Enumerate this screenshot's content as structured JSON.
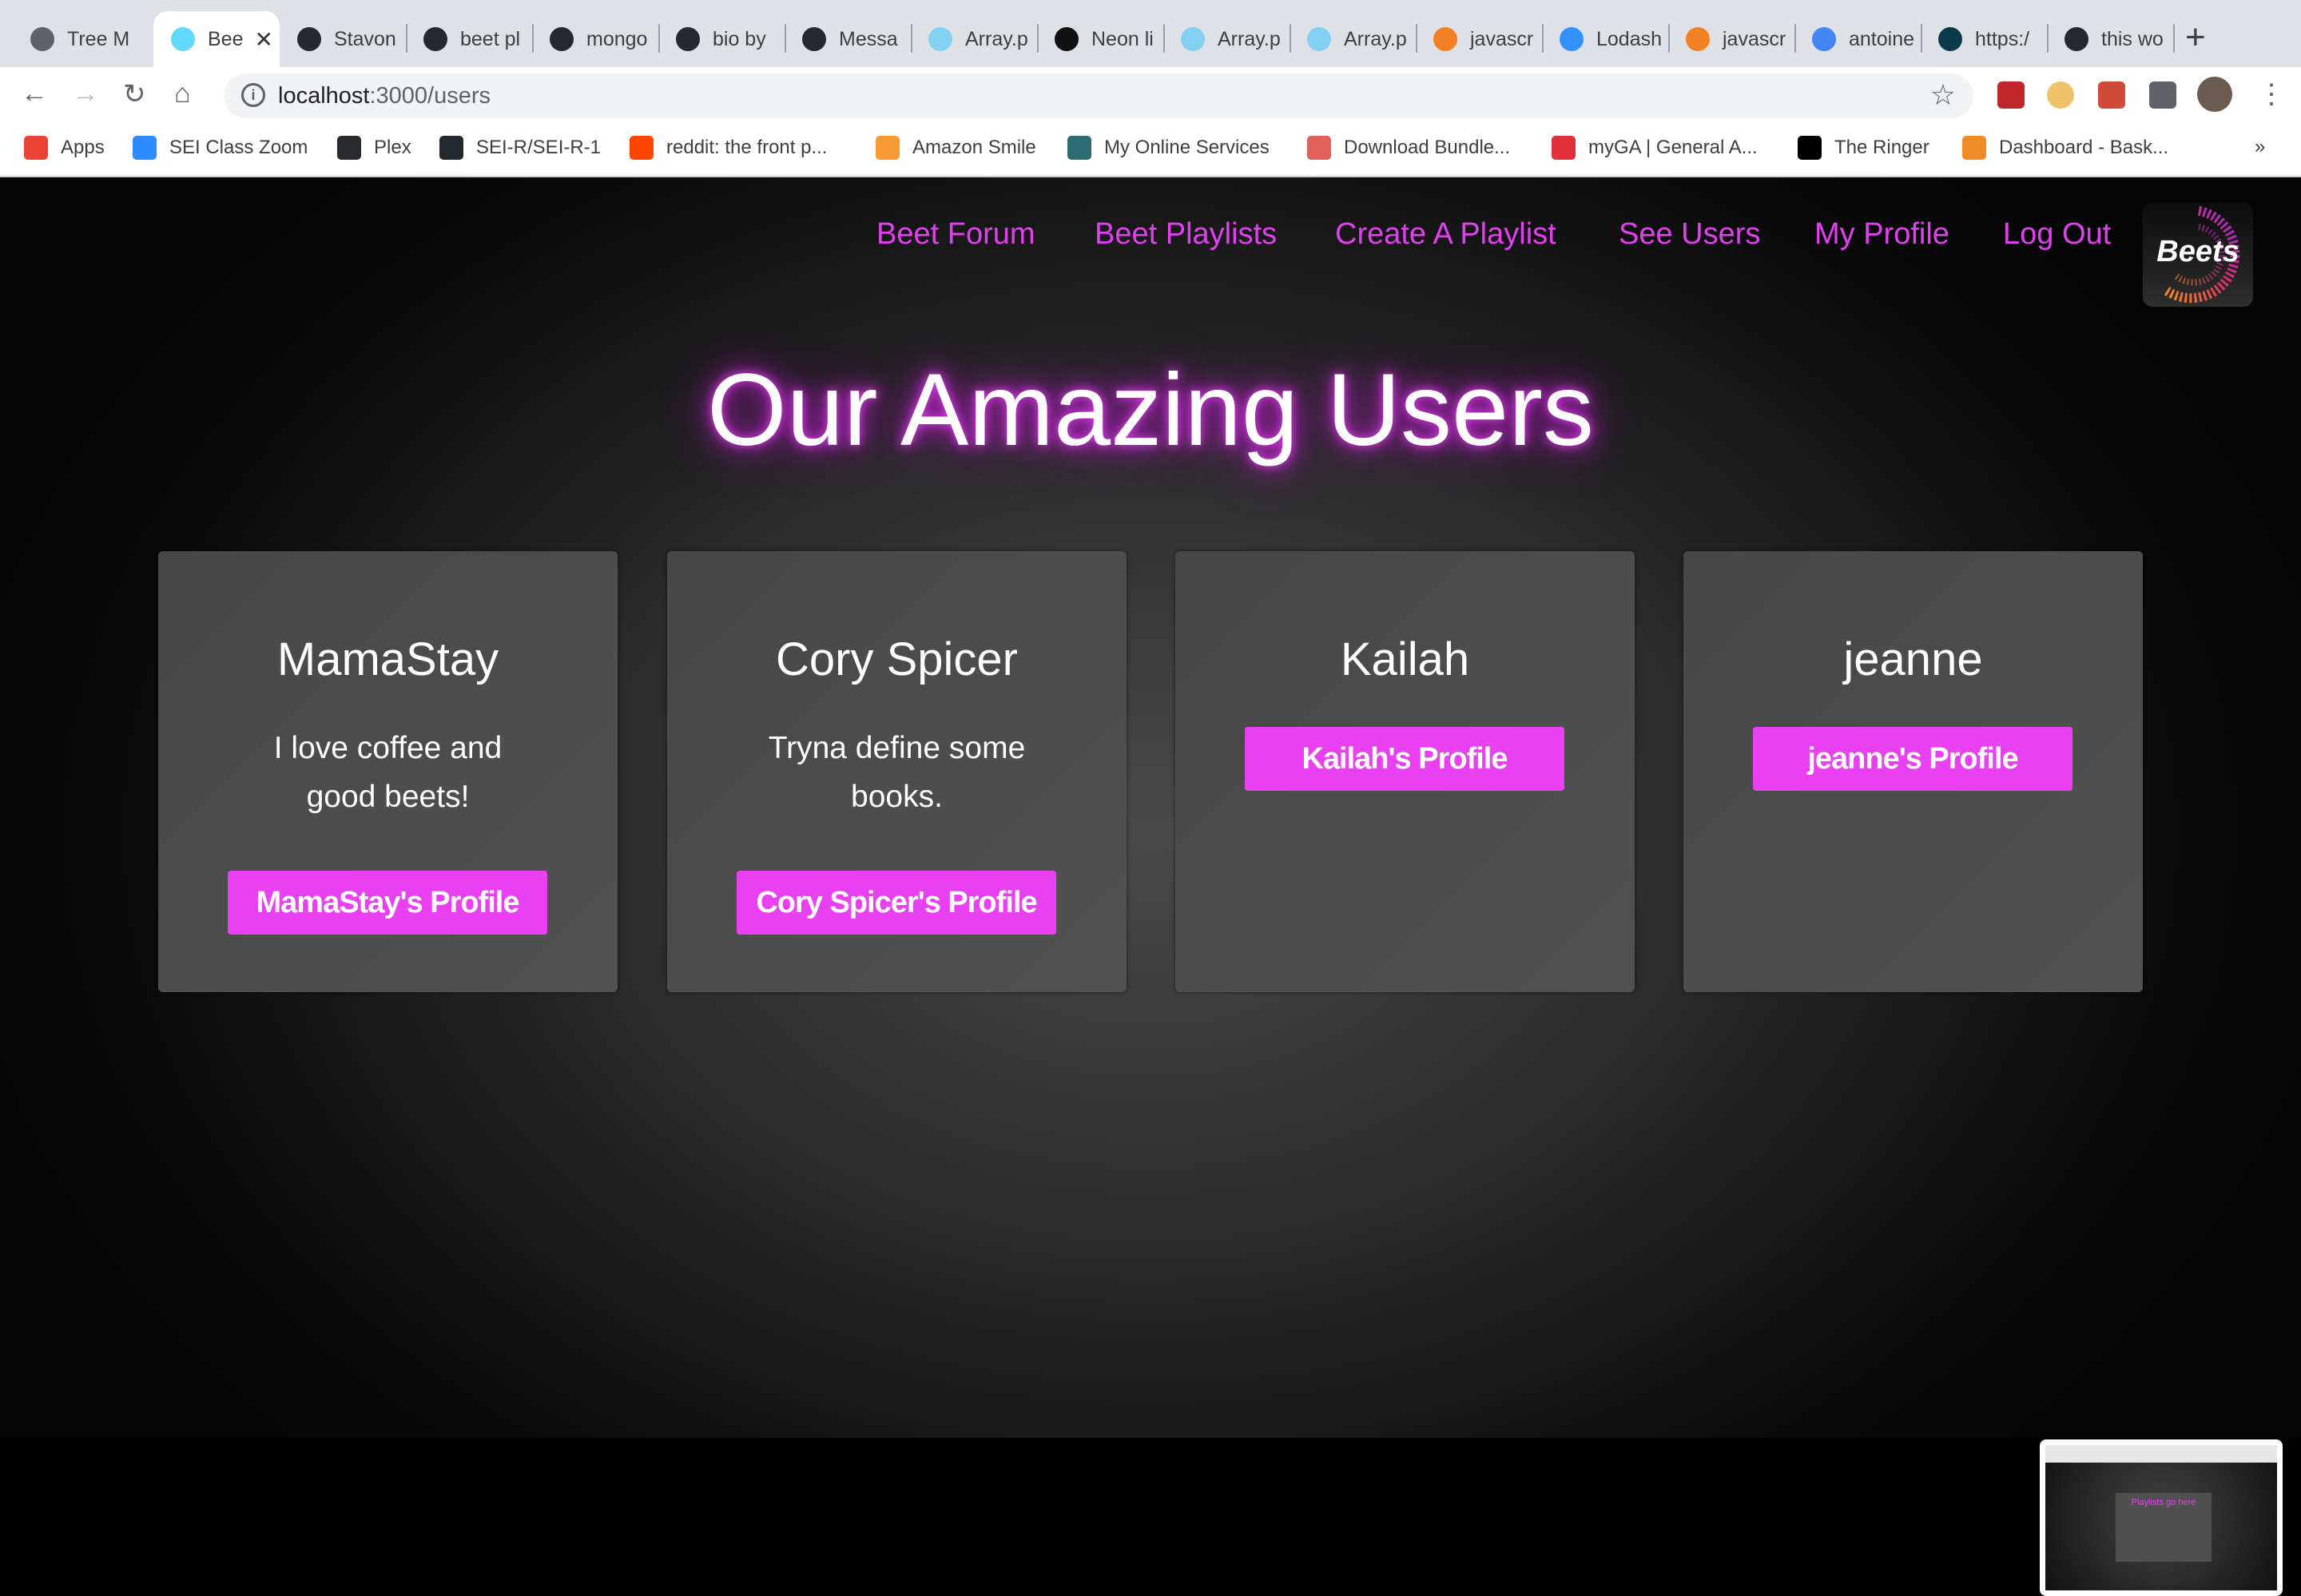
{
  "browser": {
    "tabs": [
      {
        "title": "Tree M",
        "icon": "globe-icon",
        "color": "#5f6368"
      },
      {
        "title": "Bee",
        "icon": "react-icon",
        "color": "#61dafb",
        "active": true
      },
      {
        "title": "Stavon",
        "icon": "github-icon",
        "color": "#24292e"
      },
      {
        "title": "beet pl",
        "icon": "github-icon",
        "color": "#24292e"
      },
      {
        "title": "mongo",
        "icon": "github-icon",
        "color": "#24292e"
      },
      {
        "title": "bio by",
        "icon": "github-icon",
        "color": "#24292e"
      },
      {
        "title": "Messa",
        "icon": "github-icon",
        "color": "#24292e"
      },
      {
        "title": "Array.p",
        "icon": "mdn-icon",
        "color": "#83d0f2"
      },
      {
        "title": "Neon li",
        "icon": "codepen-icon",
        "color": "#111"
      },
      {
        "title": "Array.p",
        "icon": "mdn-icon",
        "color": "#83d0f2"
      },
      {
        "title": "Array.p",
        "icon": "mdn-icon",
        "color": "#83d0f2"
      },
      {
        "title": "javascr",
        "icon": "stackoverflow-icon",
        "color": "#f48024"
      },
      {
        "title": "Lodash",
        "icon": "lodash-icon",
        "color": "#3492ff"
      },
      {
        "title": "javascr",
        "icon": "stackoverflow-icon",
        "color": "#f48024"
      },
      {
        "title": "antoine",
        "icon": "google-icon",
        "color": "#4285f4"
      },
      {
        "title": "https:/",
        "icon": "bootstrap-icon",
        "color": "#0b3b4a"
      },
      {
        "title": "this wo",
        "icon": "github-icon",
        "color": "#24292e"
      }
    ],
    "close_label": "✕",
    "new_tab_label": "+",
    "url_host": "localhost",
    "url_path": ":3000/users",
    "bookmarks": [
      {
        "label": "Apps",
        "icon": "apps-grid-icon",
        "color": "#ea4335"
      },
      {
        "label": "SEI Class Zoom",
        "icon": "zoom-icon",
        "color": "#2d8cff"
      },
      {
        "label": "Plex",
        "icon": "plex-icon",
        "color": "#282a2d"
      },
      {
        "label": "SEI-R/SEI-R-1",
        "icon": "github-icon",
        "color": "#24292e"
      },
      {
        "label": "reddit: the front p...",
        "icon": "reddit-icon",
        "color": "#ff4500"
      },
      {
        "label": "Amazon Smile",
        "icon": "amazon-icon",
        "color": "#f79c34"
      },
      {
        "label": "My Online Services",
        "icon": "ny-state-icon",
        "color": "#2e6e73"
      },
      {
        "label": "Download Bundle...",
        "icon": "store-icon",
        "color": "#e0605a"
      },
      {
        "label": "myGA | General A...",
        "icon": "ga-icon",
        "color": "#e0303a"
      },
      {
        "label": "The Ringer",
        "icon": "ringer-icon",
        "color": "#000"
      },
      {
        "label": "Dashboard - Bask...",
        "icon": "basketball-icon",
        "color": "#f08c28"
      }
    ],
    "bookmarks_overflow": "»"
  },
  "nav": {
    "links": [
      "Beet Forum",
      "Beet Playlists",
      "Create A Playlist",
      "See Users",
      "My Profile",
      "Log Out"
    ],
    "logo_text": "Beets"
  },
  "main": {
    "title": "Our Amazing Users",
    "users": [
      {
        "name": "MamaStay",
        "bio": "I love coffee and good beets!",
        "button": "MamaStay's Profile"
      },
      {
        "name": "Cory Spicer",
        "bio": "Tryna define some books.",
        "button": "Cory Spicer's Profile"
      },
      {
        "name": "Kailah",
        "bio": "",
        "button": "Kailah's Profile"
      },
      {
        "name": "jeanne",
        "bio": "",
        "button": "jeanne's Profile"
      }
    ]
  },
  "screenshot_thumbnail": {
    "title": "Playlists go here"
  },
  "colors": {
    "accent": "#e940f2",
    "nav_link": "#e23ff0"
  }
}
